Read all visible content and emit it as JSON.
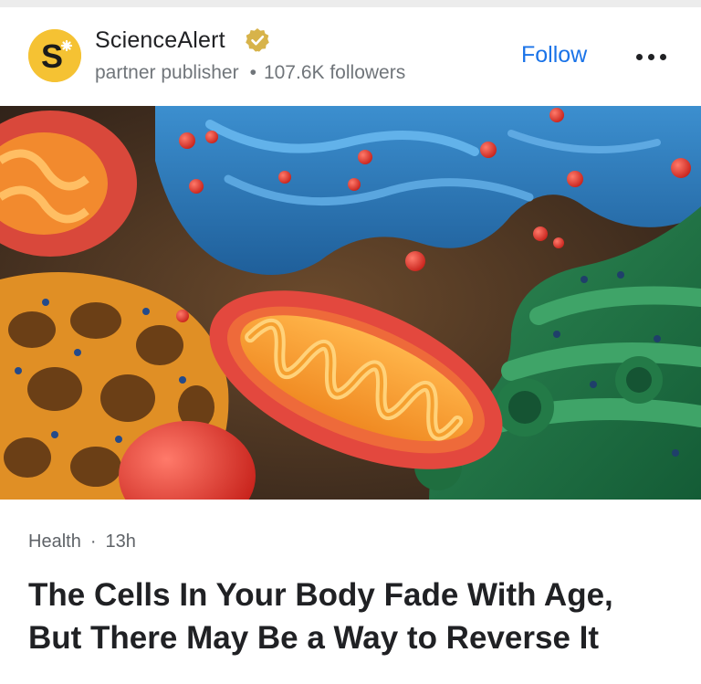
{
  "publisher": {
    "name": "ScienceAlert",
    "logo_letter": "S",
    "type": "partner publisher",
    "separator": "•",
    "followers": "107.6K followers",
    "verified_icon": "verified-badge-icon",
    "brand_color": "#f5c233"
  },
  "actions": {
    "follow_label": "Follow",
    "more_icon": "more-horizontal-icon",
    "accent_color": "#1a73e8"
  },
  "article": {
    "image_alt": "mitochondria illustration",
    "category": "Health",
    "separator": "·",
    "age": "13h",
    "headline_line1": "The Cells In Your Body Fade With Age,",
    "headline_line2": "But There May Be a Way to Reverse It"
  }
}
